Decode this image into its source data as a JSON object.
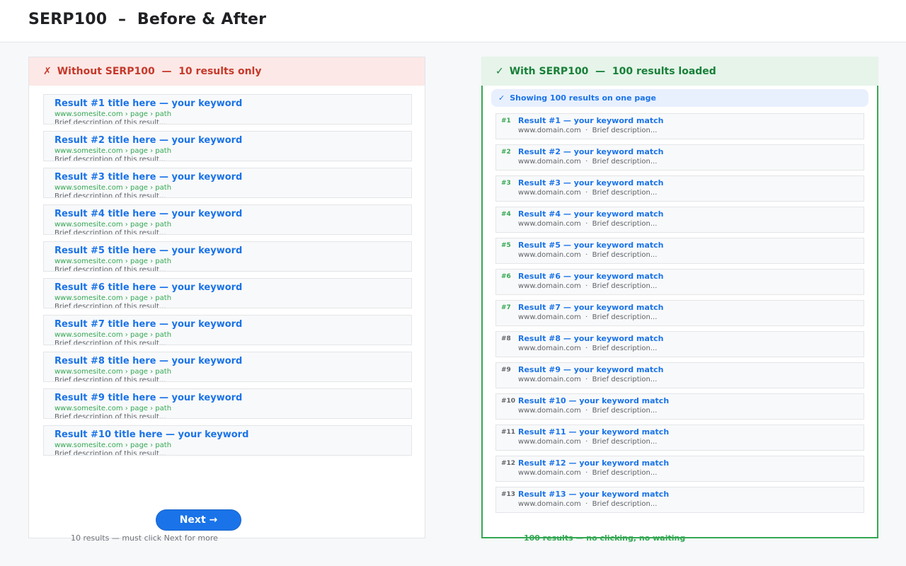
{
  "header": {
    "title": "SERP100  –  Before & After"
  },
  "left": {
    "header_mark": "✗",
    "header_text": "Without SERP100  —  10 results only",
    "results": [
      {
        "title": "Result #1 title here — your keyword",
        "url": "www.somesite.com › page › path",
        "desc": "Brief description of this result..."
      },
      {
        "title": "Result #2 title here — your keyword",
        "url": "www.somesite.com › page › path",
        "desc": "Brief description of this result..."
      },
      {
        "title": "Result #3 title here — your keyword",
        "url": "www.somesite.com › page › path",
        "desc": "Brief description of this result..."
      },
      {
        "title": "Result #4 title here — your keyword",
        "url": "www.somesite.com › page › path",
        "desc": "Brief description of this result..."
      },
      {
        "title": "Result #5 title here — your keyword",
        "url": "www.somesite.com › page › path",
        "desc": "Brief description of this result..."
      },
      {
        "title": "Result #6 title here — your keyword",
        "url": "www.somesite.com › page › path",
        "desc": "Brief description of this result..."
      },
      {
        "title": "Result #7 title here — your keyword",
        "url": "www.somesite.com › page › path",
        "desc": "Brief description of this result..."
      },
      {
        "title": "Result #8 title here — your keyword",
        "url": "www.somesite.com › page › path",
        "desc": "Brief description of this result..."
      },
      {
        "title": "Result #9 title here — your keyword",
        "url": "www.somesite.com › page › path",
        "desc": "Brief description of this result..."
      },
      {
        "title": "Result #10 title here — your keyword",
        "url": "www.somesite.com › page › path",
        "desc": "Brief description of this result..."
      }
    ],
    "next_label": "Next →",
    "footnote": "10 results — must click Next for more"
  },
  "right": {
    "header_mark": "✓",
    "header_text": "With SERP100  —  100 results loaded",
    "banner_mark": "✓",
    "banner_text": "Showing 100 results on one page",
    "results": [
      {
        "rank": "#1",
        "title": "Result #1 — your keyword match",
        "desc": "www.domain.com  ·  Brief description..."
      },
      {
        "rank": "#2",
        "title": "Result #2 — your keyword match",
        "desc": "www.domain.com  ·  Brief description..."
      },
      {
        "rank": "#3",
        "title": "Result #3 — your keyword match",
        "desc": "www.domain.com  ·  Brief description..."
      },
      {
        "rank": "#4",
        "title": "Result #4 — your keyword match",
        "desc": "www.domain.com  ·  Brief description..."
      },
      {
        "rank": "#5",
        "title": "Result #5 — your keyword match",
        "desc": "www.domain.com  ·  Brief description..."
      },
      {
        "rank": "#6",
        "title": "Result #6 — your keyword match",
        "desc": "www.domain.com  ·  Brief description..."
      },
      {
        "rank": "#7",
        "title": "Result #7 — your keyword match",
        "desc": "www.domain.com  ·  Brief description..."
      },
      {
        "rank": "#8",
        "title": "Result #8 — your keyword match",
        "desc": "www.domain.com  ·  Brief description..."
      },
      {
        "rank": "#9",
        "title": "Result #9 — your keyword match",
        "desc": "www.domain.com  ·  Brief description..."
      },
      {
        "rank": "#10",
        "title": "Result #10 — your keyword match",
        "desc": "www.domain.com  ·  Brief description..."
      },
      {
        "rank": "#11",
        "title": "Result #11 — your keyword match",
        "desc": "www.domain.com  ·  Brief description..."
      },
      {
        "rank": "#12",
        "title": "Result #12 — your keyword match",
        "desc": "www.domain.com  ·  Brief description..."
      },
      {
        "rank": "#13",
        "title": "Result #13 — your keyword match",
        "desc": "www.domain.com  ·  Brief description..."
      }
    ],
    "footnote": "100 results — no clicking, no waiting"
  },
  "colors": {
    "link_blue": "#1a73e8",
    "url_green": "#34a853",
    "accent_red": "#c5392b",
    "accent_green": "#188038",
    "rank_gray": "#5f6368"
  }
}
